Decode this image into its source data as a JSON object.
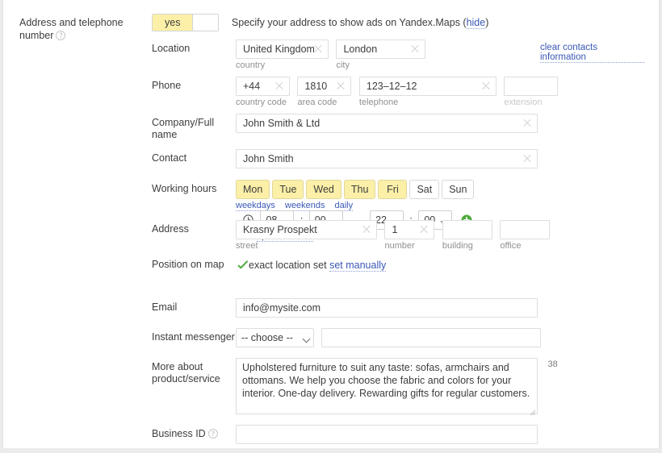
{
  "section": {
    "legend_line1": "Address and telephone",
    "legend_line2": "number",
    "help_icon_glyph": "?"
  },
  "toggle": {
    "on_label": "yes",
    "note": "Specify your address to show ads on Yandex.Maps (",
    "hide_link": "hide",
    "note_close": ")"
  },
  "location": {
    "label": "Location",
    "country_value": "United Kingdom",
    "country_sub": "country",
    "city_value": "London",
    "city_sub": "city",
    "clear_link": "clear contacts information"
  },
  "phone": {
    "label": "Phone",
    "country_code_value": "+44",
    "country_code_sub": "country code",
    "area_code_value": "1810",
    "area_code_sub": "area code",
    "telephone_value": "123–12–12",
    "telephone_sub": "telephone",
    "extension_value": "",
    "extension_sub": "extension"
  },
  "company": {
    "label_line1": "Company/Full",
    "label_line2": "name",
    "value": "John Smith & Ltd"
  },
  "contact": {
    "label": "Contact",
    "value": "John Smith"
  },
  "working_hours": {
    "label": "Working hours",
    "days": [
      {
        "name": "Mon",
        "selected": true
      },
      {
        "name": "Tue",
        "selected": true
      },
      {
        "name": "Wed",
        "selected": true
      },
      {
        "name": "Thu",
        "selected": true
      },
      {
        "name": "Fri",
        "selected": true
      },
      {
        "name": "Sat",
        "selected": false
      },
      {
        "name": "Sun",
        "selected": false
      }
    ],
    "preset_links": [
      "weekdays",
      "weekends",
      "daily"
    ],
    "clock_icon": "clock-icon",
    "from_hour": "08",
    "from_minute": "00",
    "to_hour": "22",
    "to_minute": "00",
    "separator": "—",
    "colon": ":",
    "open_24_link": "open 24 hours",
    "add_icon": "plus-circle-icon"
  },
  "address": {
    "label": "Address",
    "street_value": "Krasny Prospekt",
    "street_sub": "street",
    "number_value": "1",
    "number_sub": "number",
    "building_value": "",
    "building_sub": "building",
    "office_value": "",
    "office_sub": "office"
  },
  "position_on_map": {
    "label": "Position on map",
    "check_icon": "green-check-icon",
    "status": "exact location set",
    "manual_link": "set manually"
  },
  "email": {
    "label": "Email",
    "value": "info@mysite.com"
  },
  "messenger": {
    "label": "Instant messenger",
    "selected": "-- choose --",
    "account_value": ""
  },
  "more_about": {
    "label_line1": "More about",
    "label_line2": "product/service",
    "text": "Upholstered furniture to suit any taste: sofas, armchairs and ottomans. We help you choose the fabric and colors for your interior. One-day delivery. Rewarding gifts for regular customers.",
    "counter": "38"
  },
  "business_id": {
    "label": "Business ID",
    "value": ""
  },
  "colors": {
    "accent_yellow": "#fcf0a8",
    "link_blue": "#3a58b5",
    "green": "#3aaa35",
    "text": "#3d3d3d",
    "border": "#dedede"
  }
}
